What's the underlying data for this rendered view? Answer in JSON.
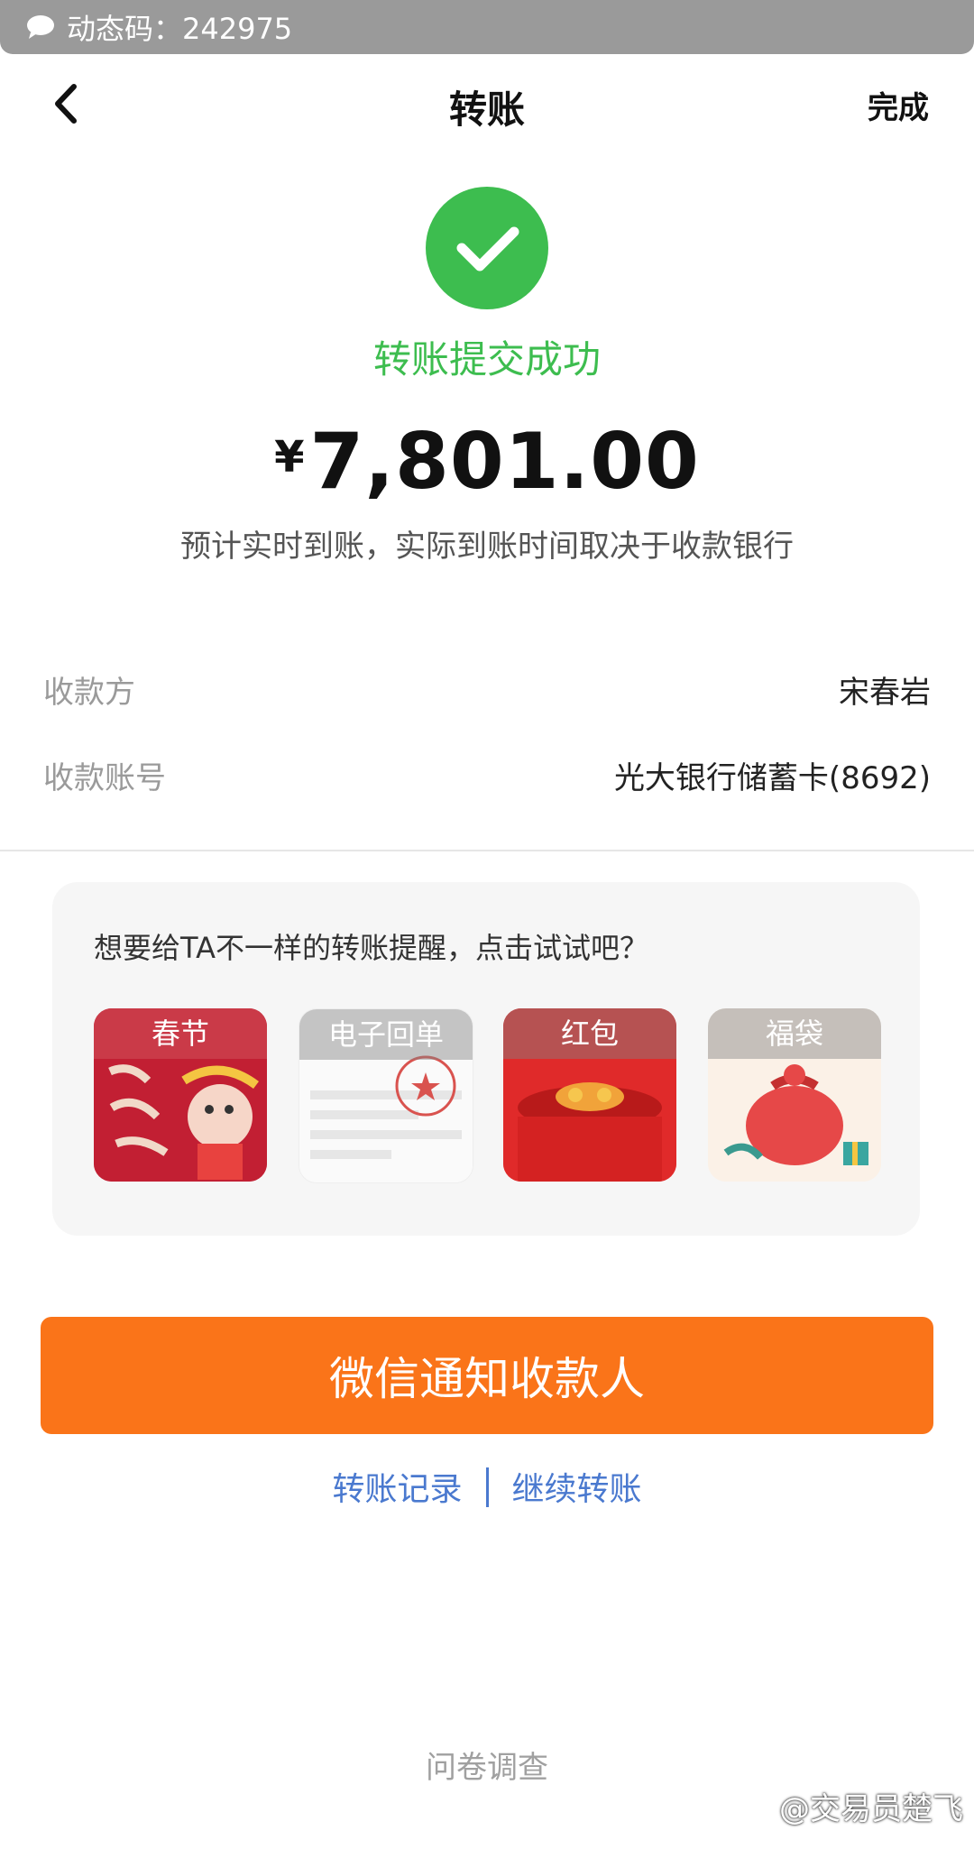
{
  "notification": {
    "icon": "chat-bubble-icon",
    "text": "动态码：242975"
  },
  "nav": {
    "back_icon": "chevron-left-icon",
    "title": "转账",
    "done_label": "完成"
  },
  "status": {
    "icon": "checkmark-circle-icon",
    "text": "转账提交成功",
    "color": "#3dbd4f"
  },
  "amount": {
    "currency": "¥",
    "value": "7,801.00"
  },
  "eta_text": "预计实时到账，实际到账时间取决于收款银行",
  "details": [
    {
      "label": "收款方",
      "value": "宋春岩"
    },
    {
      "label": "收款账号",
      "value": "光大银行储蓄卡(8692)"
    }
  ],
  "reminder": {
    "title": "想要给TA不一样的转账提醒，点击试试吧？",
    "options": [
      {
        "label": "春节"
      },
      {
        "label": "电子回单"
      },
      {
        "label": "红包"
      },
      {
        "label": "福袋"
      }
    ]
  },
  "notify_button": {
    "label": "微信通知收款人",
    "color": "#fa7419"
  },
  "links": {
    "record": "转账记录",
    "continue": "继续转账",
    "color": "#4a79cf"
  },
  "survey": "问卷调查",
  "watermark": "@交易员楚飞"
}
